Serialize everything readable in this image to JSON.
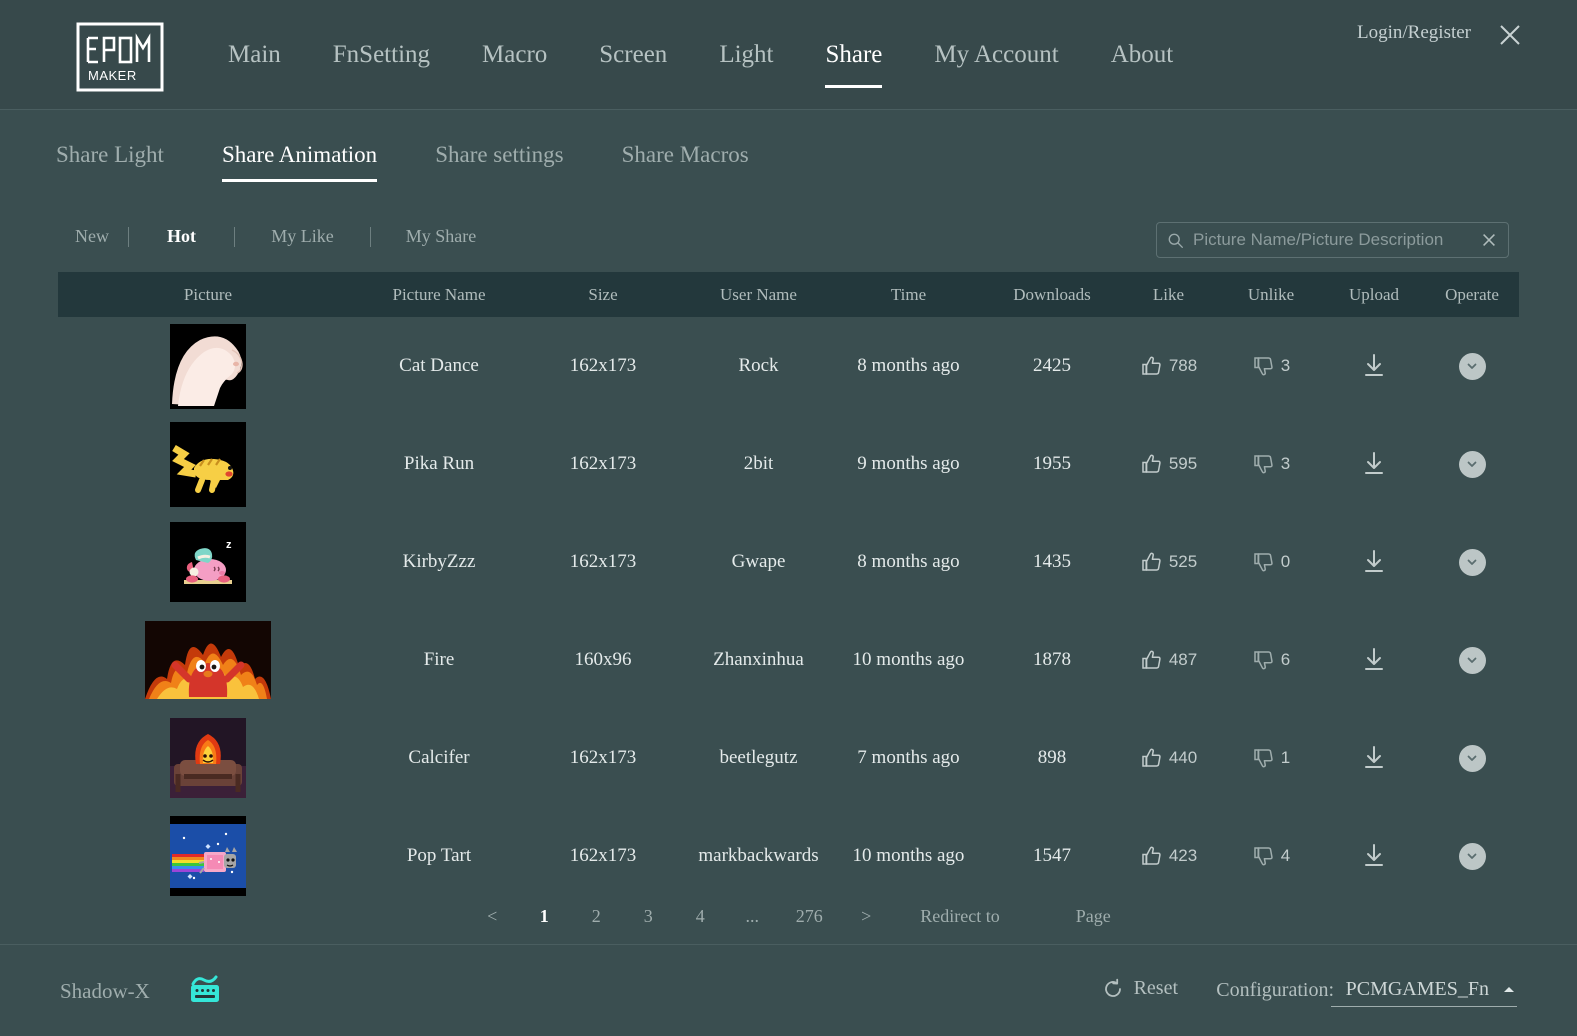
{
  "app": {
    "logo_text_top": "EPOM",
    "logo_text_bottom": "MAKER",
    "login_label": "Login/Register",
    "close_icon": "close-icon"
  },
  "main_nav": [
    {
      "label": "Main",
      "active": false
    },
    {
      "label": "FnSetting",
      "active": false
    },
    {
      "label": "Macro",
      "active": false
    },
    {
      "label": "Screen",
      "active": false
    },
    {
      "label": "Light",
      "active": false
    },
    {
      "label": "Share",
      "active": true
    },
    {
      "label": "My Account",
      "active": false
    },
    {
      "label": "About",
      "active": false
    }
  ],
  "sub_tabs": [
    {
      "label": "Share Light",
      "active": false
    },
    {
      "label": "Share Animation",
      "active": true
    },
    {
      "label": "Share settings",
      "active": false
    },
    {
      "label": "Share Macros",
      "active": false
    }
  ],
  "filters": [
    {
      "label": "New",
      "active": false
    },
    {
      "label": "Hot",
      "active": true
    },
    {
      "label": "My Like",
      "active": false
    },
    {
      "label": "My Share",
      "active": false
    }
  ],
  "search": {
    "placeholder": "Picture Name/Picture Description",
    "value": "",
    "search_icon": "search-icon",
    "clear_icon": "close-icon"
  },
  "table": {
    "headers": {
      "picture": "Picture",
      "picture_name": "Picture Name",
      "size": "Size",
      "user_name": "User Name",
      "time": "Time",
      "downloads": "Downloads",
      "like": "Like",
      "unlike": "Unlike",
      "upload": "Upload",
      "operate": "Operate"
    },
    "rows": [
      {
        "picture_name": "Cat Dance",
        "size": "162x173",
        "user_name": "Rock",
        "time": "8 months ago",
        "downloads": "2425",
        "like": "788",
        "unlike": "3",
        "thumb": "cat-dance-thumbnail"
      },
      {
        "picture_name": "Pika Run",
        "size": "162x173",
        "user_name": "2bit",
        "time": "9 months ago",
        "downloads": "1955",
        "like": "595",
        "unlike": "3",
        "thumb": "pika-run-thumbnail"
      },
      {
        "picture_name": "KirbyZzz",
        "size": "162x173",
        "user_name": "Gwape",
        "time": "8 months ago",
        "downloads": "1435",
        "like": "525",
        "unlike": "0",
        "thumb": "kirby-zzz-thumbnail"
      },
      {
        "picture_name": "Fire",
        "size": "160x96",
        "user_name": "Zhanxinhua",
        "time": "10 months ago",
        "downloads": "1878",
        "like": "487",
        "unlike": "6",
        "thumb": "fire-thumbnail"
      },
      {
        "picture_name": "Calcifer",
        "size": "162x173",
        "user_name": "beetlegutz",
        "time": "7 months ago",
        "downloads": "898",
        "like": "440",
        "unlike": "1",
        "thumb": "calcifer-thumbnail"
      },
      {
        "picture_name": "Pop Tart",
        "size": "162x173",
        "user_name": "markbackwards",
        "time": "10 months ago",
        "downloads": "1547",
        "like": "423",
        "unlike": "4",
        "thumb": "pop-tart-thumbnail"
      }
    ]
  },
  "pagination": {
    "prev": "<",
    "pages": [
      "1",
      "2",
      "3",
      "4"
    ],
    "ellipsis": "...",
    "last_page": "276",
    "next": ">",
    "current": "1",
    "redirect_label": "Redirect to",
    "page_label": "Page",
    "page_input_value": ""
  },
  "footer": {
    "keyboard_name": "Shadow-X",
    "keyboard_icon": "keyboard-icon",
    "reset_label": "Reset",
    "reset_icon": "refresh-icon",
    "configuration_label": "Configuration:",
    "configuration_value": "PCMGAMES_Fn",
    "configuration_caret": "chevron-up-icon"
  },
  "colors": {
    "background": "#3a4e50",
    "topbar": "#37494b",
    "table_header": "#23383c",
    "accent_cyan": "#35e6d8",
    "text_muted": "#9fadad",
    "text_bright": "#ffffff"
  }
}
